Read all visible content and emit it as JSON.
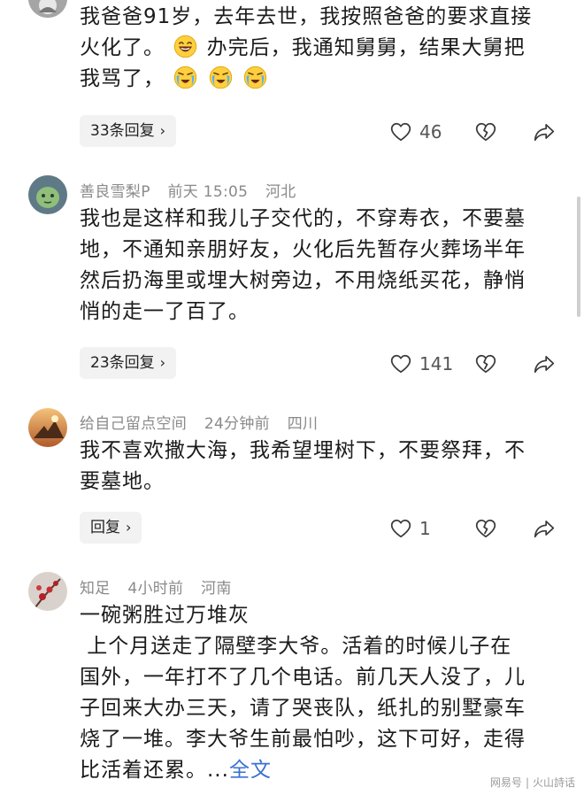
{
  "comments": [
    {
      "lines": [
        "我爸爸91岁，去年去世，我按照爸爸的要求直接",
        "火化了。",
        "办完后，我通知舅舅，结果大舅把",
        "我骂了，"
      ],
      "replies_label": "33条回复",
      "likes": "46",
      "emojis": [
        "laughing-crying-emoji",
        "crying-emoji"
      ]
    },
    {
      "user": "善良雪梨P",
      "time": "前天 15:05",
      "location": "河北",
      "lines": [
        "我也是这样和我儿子交代的，不穿寿衣，不要墓",
        "地，不通知亲朋好友，火化后先暂存火葬场半年",
        "然后扔海里或埋大树旁边，不用烧纸买花，静悄",
        "悄的走一了百了。"
      ],
      "replies_label": "23条回复",
      "likes": "141"
    },
    {
      "user": "给自己留点空间",
      "time": "24分钟前",
      "location": "四川",
      "lines": [
        "我不喜欢撒大海，我希望埋树下，不要祭拜，不",
        "要墓地。"
      ],
      "replies_label": "回复",
      "likes": "1"
    },
    {
      "user": "知足",
      "time": "4小时前",
      "location": "河南",
      "lines": [
        "一碗粥胜过万堆灰",
        " 上个月送走了隔壁李大爷。活着的时候儿子在",
        "国外，一年打不了几个电话。前几天人没了，儿",
        "子回来大办三天，请了哭丧队，纸扎的别墅豪车",
        "烧了一堆。李大爷生前最怕吵，这下可好，走得",
        "比活着还累。..."
      ],
      "more_label": "全文"
    }
  ],
  "watermark": {
    "left": "网易号",
    "right": "火山詩话"
  },
  "colors": {
    "link": "#3b6fd6",
    "meta": "#8a8a8a",
    "pill_bg": "#f2f2f2"
  }
}
